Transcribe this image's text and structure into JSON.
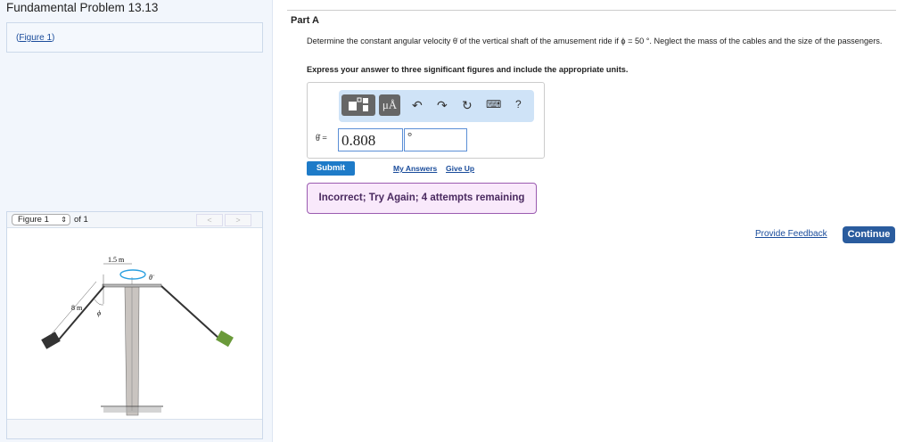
{
  "left": {
    "title": "Fundamental Problem 13.13",
    "figure_link": "Figure 1",
    "viewer": {
      "select": "Figure 1",
      "of": "of 1",
      "prev": "<",
      "next": ">",
      "figure_labels": {
        "radius": "1.5 m",
        "cable": "8 m",
        "angle": "ϕ",
        "omega": "θ̇"
      }
    }
  },
  "part": {
    "title": "Part A",
    "question": "Determine the constant angular velocity θ̇ of the vertical shaft of the amusement ride if ϕ = 50 °. Neglect the mass of the cables and the size of the passengers.",
    "instruction": "Express your answer to three significant figures and include the appropriate units.",
    "toolbar": {
      "templates": "templates-icon",
      "units": "μÅ",
      "undo": "↶",
      "redo": "↷",
      "reset": "↻",
      "keyboard": "⌨",
      "help": "?"
    },
    "answer_label": "θ̇ =",
    "value": "0.808",
    "units": "°",
    "submit": "Submit",
    "my_answers": "My Answers",
    "give_up": "Give Up",
    "feedback": "Incorrect; Try Again; 4 attempts remaining"
  },
  "footer": {
    "provide_feedback": "Provide Feedback",
    "continue": "Continue"
  }
}
